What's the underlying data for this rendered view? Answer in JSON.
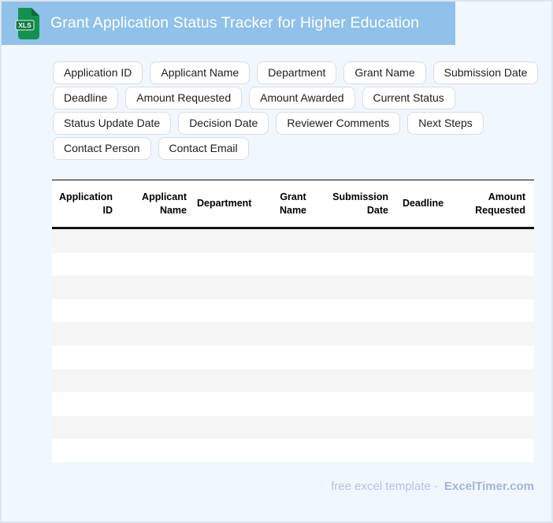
{
  "window": {
    "background": "#f0f7ff",
    "border_color": "#dde5ef"
  },
  "header": {
    "title": "Grant Application Status Tracker for Higher Education",
    "bar_color": "#90c1ea",
    "icon": {
      "name": "xls-file-icon",
      "label": "XLS",
      "body_color": "#12914f",
      "fold_color": "#0a6b38",
      "band_color": "#0c7a43"
    }
  },
  "field_chips": {
    "row1": [
      "Application ID",
      "Applicant Name",
      "Department",
      "Grant Name",
      "Submission Date"
    ],
    "row2": [
      "Deadline",
      "Amount Requested",
      "Amount Awarded",
      "Current Status"
    ],
    "row3": [
      "Status Update Date",
      "Decision Date",
      "Reviewer Comments",
      "Next Steps"
    ],
    "row4": [
      "Contact Person",
      "Contact Email"
    ]
  },
  "table": {
    "columns": [
      {
        "label": "Application ID",
        "align": "right"
      },
      {
        "label": "Applicant Name",
        "align": "right"
      },
      {
        "label": "Department",
        "align": "left"
      },
      {
        "label": "Grant Name",
        "align": "center"
      },
      {
        "label": "Submission Date",
        "align": "right"
      },
      {
        "label": "Deadline",
        "align": "center"
      },
      {
        "label": "Amount Requested",
        "align": "right"
      }
    ],
    "empty_row_count": 10,
    "row_colors": {
      "odd": "#f5f5f5",
      "even": "#ffffff"
    }
  },
  "footer": {
    "text": "free excel template -",
    "brand": "ExcelTimer.com"
  }
}
